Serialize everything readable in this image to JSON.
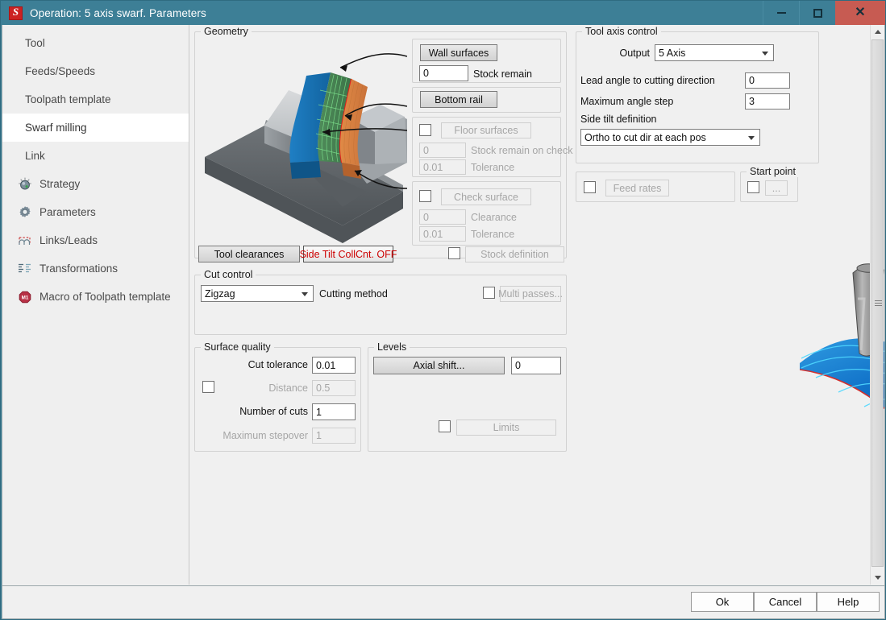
{
  "window": {
    "title": "Operation: 5 axis swarf. Parameters",
    "app_icon": "solidcam-s-icon",
    "controls": {
      "minimize": "minimize-icon",
      "maximize": "maximize-icon",
      "close": "close-icon",
      "close_label": "✕"
    },
    "accent_color": "#3d7f96",
    "close_color": "#c75b52"
  },
  "sidebar": {
    "items": [
      {
        "label": "Tool",
        "icon": "",
        "selected": false
      },
      {
        "label": "Feeds/Speeds",
        "icon": "",
        "selected": false
      },
      {
        "label": "Toolpath template",
        "icon": "",
        "selected": false
      },
      {
        "label": "Swarf milling",
        "icon": "",
        "selected": true
      },
      {
        "label": "Link",
        "icon": "",
        "selected": false
      },
      {
        "label": "Strategy",
        "icon": "dial-icon",
        "selected": false
      },
      {
        "label": "Parameters",
        "icon": "gear-icon",
        "selected": false
      },
      {
        "label": "Links/Leads",
        "icon": "link-arc-icon",
        "selected": false
      },
      {
        "label": "Transformations",
        "icon": "list-lines-icon",
        "selected": false
      },
      {
        "label": "Macro of Toolpath template",
        "icon": "macro-m1-icon",
        "selected": false
      }
    ]
  },
  "geometry": {
    "legend": "Geometry",
    "wall_surfaces_button": "Wall surfaces",
    "stock_remain_value": "0",
    "stock_remain_label": "Stock remain",
    "bottom_rail_button": "Bottom rail",
    "floor_surfaces_button": "Floor surfaces",
    "floor_surfaces_checked": false,
    "floor_stock_value": "0",
    "floor_stock_label": "Stock remain on check",
    "floor_tolerance_value": "0.01",
    "floor_tolerance_label": "Tolerance",
    "check_surface_button": "Check surface",
    "check_surface_checked": false,
    "check_clearance_value": "0",
    "check_clearance_label": "Clearance",
    "check_tolerance_value": "0.01",
    "check_tolerance_label": "Tolerance"
  },
  "tool_axis_control": {
    "legend": "Tool axis control",
    "output_label": "Output",
    "output_value": "5 Axis",
    "lead_angle_label": "Lead angle to cutting direction",
    "lead_angle_value": "0",
    "max_angle_step_label": "Maximum angle step",
    "max_angle_step_value": "3",
    "side_tilt_label": "Side tilt definition",
    "side_tilt_value": "Ortho to cut dir at each pos"
  },
  "feed_rates": {
    "button": "Feed rates",
    "checked": false
  },
  "start_point": {
    "legend": "Start point",
    "button": "...",
    "checked": false
  },
  "middle_row": {
    "tool_clearances_button": "Tool clearances",
    "side_tilt_collcnt_button": "Side Tilt CollCnt. OFF",
    "side_tilt_collcnt_color": "#cc0000",
    "stock_definition_button": "Stock definition",
    "stock_definition_checked": false
  },
  "cut_control": {
    "legend": "Cut control",
    "cutting_method_value": "Zigzag",
    "cutting_method_label": "Cutting method",
    "multi_passes_button": "Multi passes...",
    "multi_passes_checked": false
  },
  "surface_quality": {
    "legend": "Surface quality",
    "cut_tolerance_label": "Cut tolerance",
    "cut_tolerance_value": "0.01",
    "distance_label": "Distance",
    "distance_value": "0.5",
    "distance_checked": false,
    "number_of_cuts_label": "Number of cuts",
    "number_of_cuts_value": "1",
    "maximum_stepover_label": "Maximum stepover",
    "maximum_stepover_value": "1"
  },
  "levels": {
    "legend": "Levels",
    "axial_shift_button": "Axial shift...",
    "axial_shift_value": "0",
    "limits_button": "Limits",
    "limits_checked": false
  },
  "footer": {
    "ok": "Ok",
    "cancel": "Cancel",
    "help": "Help"
  },
  "scrollbar": {
    "up": "scroll-up-icon",
    "down": "scroll-down-icon"
  }
}
